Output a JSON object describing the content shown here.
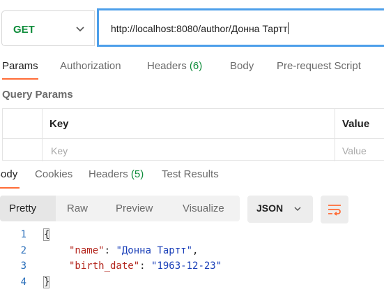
{
  "request": {
    "method": "GET",
    "url": "http://localhost:8080/author/Донна Тартт"
  },
  "request_tabs": [
    {
      "label": "Params",
      "active": true
    },
    {
      "label": "Authorization"
    },
    {
      "label": "Headers",
      "count": "(6)"
    },
    {
      "label": "Body"
    },
    {
      "label": "Pre-request Script"
    }
  ],
  "query_params": {
    "title": "Query Params",
    "columns": [
      "Key",
      "Value"
    ],
    "placeholders": {
      "key": "Key",
      "value": "Value"
    }
  },
  "response_tabs": [
    {
      "label": "Body",
      "active": true
    },
    {
      "label": "Cookies"
    },
    {
      "label": "Headers",
      "count": "(5)"
    },
    {
      "label": "Test Results"
    }
  ],
  "format_tabs": [
    "Pretty",
    "Raw",
    "Preview",
    "Visualize"
  ],
  "format_selected": "JSON",
  "response_body": {
    "line_numbers": [
      "1",
      "2",
      "3",
      "4"
    ],
    "open_brace": "{",
    "close_brace": "}",
    "fields": [
      {
        "key": "\"name\"",
        "value": "\"Донна Тартт\"",
        "trail": ","
      },
      {
        "key": "\"birth_date\"",
        "value": "\"1963-12-23\"",
        "trail": ""
      }
    ]
  },
  "colors": {
    "accent": "#ff6c37",
    "method_green": "#0e8c3a",
    "url_focus": "#4d9fea",
    "json_key": "#b3251c",
    "json_string": "#1a3fb8",
    "line_number": "#2a6fba"
  },
  "icons": {
    "method_dropdown": "chevron-down-icon",
    "format_dropdown": "chevron-down-icon",
    "wrap": "wrap-lines-icon"
  }
}
